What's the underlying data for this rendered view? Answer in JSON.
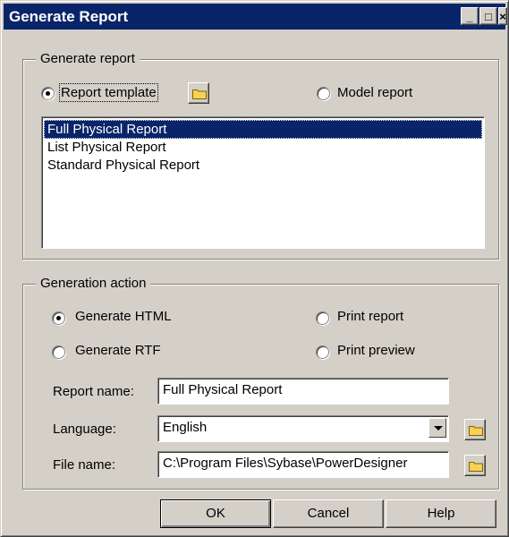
{
  "window": {
    "title": "Generate Report",
    "controls": {
      "minimize": "_",
      "maximize": "□",
      "close": "×"
    }
  },
  "generate_report_group": {
    "legend": "Generate report",
    "report_template_label": "Report template",
    "model_report_label": "Model report",
    "selected": "report_template",
    "templates": [
      {
        "label": "Full Physical Report",
        "selected": true
      },
      {
        "label": "List Physical Report",
        "selected": false
      },
      {
        "label": "Standard Physical Report",
        "selected": false
      }
    ]
  },
  "generation_action_group": {
    "legend": "Generation action",
    "generate_html_label": "Generate HTML",
    "generate_rtf_label": "Generate RTF",
    "print_report_label": "Print report",
    "print_preview_label": "Print preview",
    "selected": "generate_html",
    "report_name_label": "Report name:",
    "report_name_value": "Full Physical Report",
    "language_label": "Language:",
    "language_value": "English",
    "file_name_label": "File name:",
    "file_name_value": "C:\\Program Files\\Sybase\\PowerDesigner"
  },
  "buttons": {
    "ok": "OK",
    "cancel": "Cancel",
    "help": "Help"
  },
  "icons": {
    "folder": "folder-icon",
    "colors": {
      "folder_fill": "#f7d154",
      "folder_outline": "#806000"
    }
  }
}
